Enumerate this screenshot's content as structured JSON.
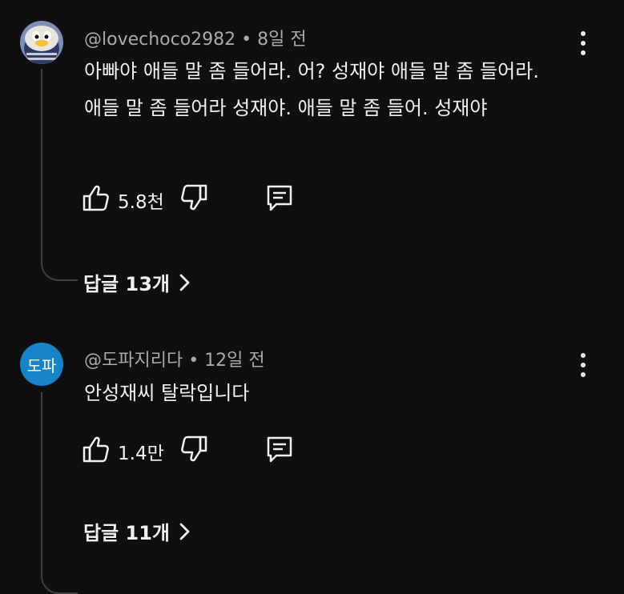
{
  "comments": [
    {
      "handle": "@lovechoco2982",
      "time": "8일 전",
      "text": "아빠야 애들 말 좀 들어라. 어? 성재야 애들 말 좀 들어라. 애들 말 좀 들어라 성재야. 애들 말 좀 들어. 성재야",
      "likes": "5.8천",
      "replies": "답글 13개",
      "avatar_icon": "cartoon-penguin-avatar"
    },
    {
      "handle": "@도파지리다",
      "time": "12일 전",
      "text": "안성재씨 탈락입니다",
      "likes": "1.4만",
      "replies": "답글 11개",
      "avatar_text": "도파",
      "avatar_color": "#1784c9"
    }
  ],
  "separator": "•",
  "colors": {
    "background": "#0f0f0f",
    "text": "#f1f1f1",
    "meta": "#aaaaaa",
    "thread_line": "#3f3f3f"
  }
}
